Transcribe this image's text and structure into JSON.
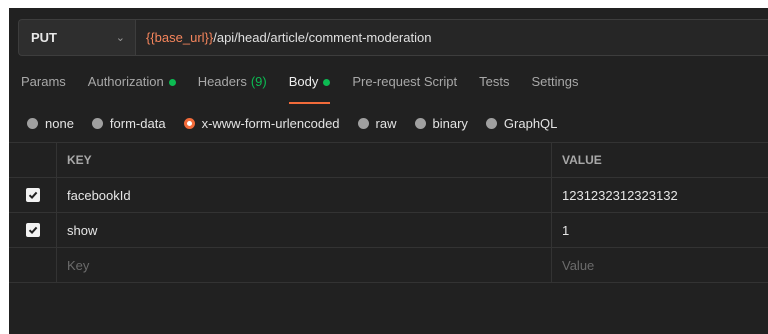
{
  "request": {
    "method": "PUT",
    "url_variable": "{{base_url}}",
    "url_path": "/api/head/article/comment-moderation"
  },
  "tabs": [
    {
      "label": "Params"
    },
    {
      "label": "Authorization"
    },
    {
      "label": "Headers",
      "count": "(9)"
    },
    {
      "label": "Body"
    },
    {
      "label": "Pre-request Script"
    },
    {
      "label": "Tests"
    },
    {
      "label": "Settings"
    }
  ],
  "body_types": [
    "none",
    "form-data",
    "x-www-form-urlencoded",
    "raw",
    "binary",
    "GraphQL"
  ],
  "body_type_selected": "x-www-form-urlencoded",
  "table": {
    "headers": {
      "key": "KEY",
      "value": "VALUE"
    },
    "rows": [
      {
        "key": "facebookId",
        "value": "1231232312323132"
      },
      {
        "key": "show",
        "value": "1"
      }
    ],
    "placeholder": {
      "key": "Key",
      "value": "Value"
    }
  },
  "colors": {
    "accent": "#f26b3a",
    "status_green": "#0cbb52",
    "background": "#212121"
  }
}
